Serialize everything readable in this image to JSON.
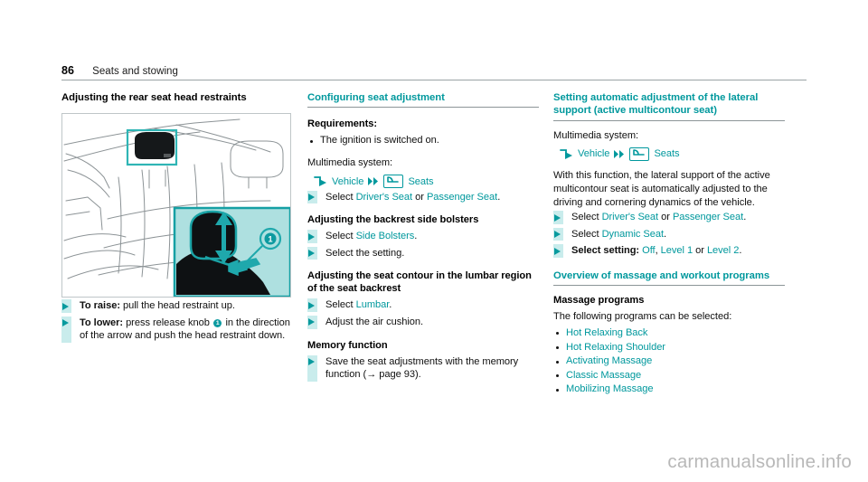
{
  "header": {
    "page_number": "86",
    "chapter_title": "Seats and stowing"
  },
  "column_left": {
    "heading": "Adjusting the rear seat head restraints",
    "figure": {
      "name": "rear-seat-head-restraint-illustration",
      "callout_number": "1",
      "description": "Rear seat bench with head restraint highlighted and inset detail showing release knob"
    },
    "steps": [
      {
        "bold_lead": "To raise:",
        "text": " pull the head restraint up."
      },
      {
        "bold_lead": "To lower:",
        "text_before_badge": " press release knob ",
        "badge": "1",
        "text_after_badge": " in the direction of the arrow and push the head restraint down."
      }
    ]
  },
  "column_middle": {
    "heading": "Configuring seat adjustment",
    "requirements_heading": "Requirements:",
    "requirements": [
      "The ignition is switched on."
    ],
    "multimedia_label": "Multimedia system:",
    "mmi_path": {
      "arrow_icon": "arrow-turn-right-icon",
      "first": "Vehicle",
      "chevron_icon": "double-chevron-right-icon",
      "seat_icon": "seat-icon",
      "second": "Seats"
    },
    "select_step": {
      "prefix": "Select ",
      "option_a": "Driver's Seat",
      "conjunction": " or ",
      "option_b": "Passenger Seat",
      "suffix": "."
    },
    "bolsters_heading": "Adjusting the backrest side bolsters",
    "bolsters_steps": [
      {
        "prefix": "Select ",
        "link": "Side Bolsters",
        "suffix": "."
      },
      {
        "prefix": "Select the setting.",
        "link": "",
        "suffix": ""
      }
    ],
    "lumbar_heading": "Adjusting the seat contour in the lumbar region of the seat backrest",
    "lumbar_steps": [
      {
        "prefix": "Select ",
        "link": "Lumbar",
        "suffix": "."
      },
      {
        "prefix": "Adjust the air cushion.",
        "link": "",
        "suffix": ""
      }
    ],
    "memory_heading": "Memory function",
    "memory_step": "Save the seat adjustments with the memory function (→ page 93)."
  },
  "column_right": {
    "heading": "Setting automatic adjustment of the lateral support (active multicontour seat)",
    "multimedia_label": "Multimedia system:",
    "mmi_path": {
      "arrow_icon": "arrow-turn-right-icon",
      "first": "Vehicle",
      "chevron_icon": "double-chevron-right-icon",
      "seat_icon": "seat-icon",
      "second": "Seats"
    },
    "description": "With this function, the lateral support of the active multicontour seat is automatically adjusted to the driving and cornering dynamics of the vehicle.",
    "steps": [
      {
        "prefix": "Select ",
        "link_a": "Driver's Seat",
        "mid": " or ",
        "link_b": "Passenger Seat",
        "suffix": "."
      },
      {
        "prefix": "Select ",
        "link_a": "Dynamic Seat",
        "mid": "",
        "link_b": "",
        "suffix": "."
      },
      {
        "prefix": "Select setting:",
        "link_a": "Off",
        "mid": ", ",
        "link_b": "Level 1",
        "mid2": " or ",
        "link_c": "Level 2",
        "suffix": "."
      }
    ],
    "overview_heading": "Overview of massage and workout programs",
    "massage_heading": "Massage programs",
    "massage_intro": "The following programs can be selected:",
    "massage_programs": [
      "Hot Relaxing Back",
      "Hot Relaxing Shoulder",
      "Activating Massage",
      "Classic Massage",
      "Mobilizing Massage"
    ]
  },
  "watermark": "carmanualsonline.info",
  "colors": {
    "teal": "#00989d",
    "teal_light": "#c9ecec",
    "figure_inset_bg": "#aee0e0",
    "rule_gray": "#9aa3a6",
    "watermark_gray": "#b8b8b8"
  }
}
